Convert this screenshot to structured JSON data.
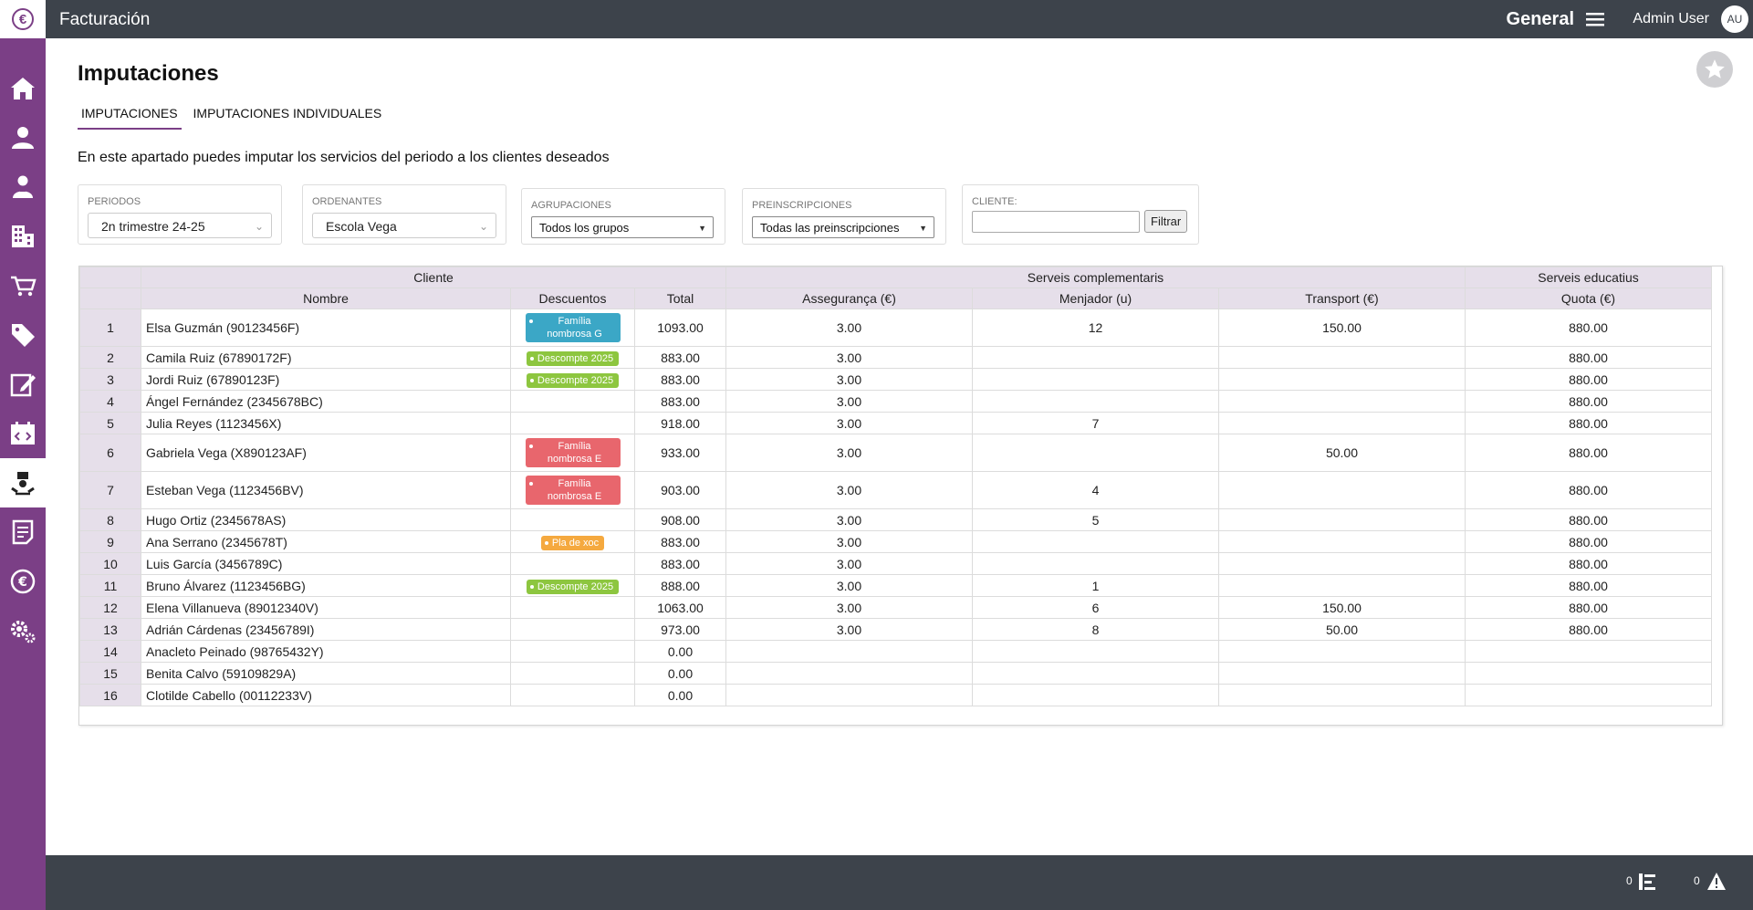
{
  "app": {
    "logo_glyph": "€",
    "title": "Facturación",
    "company": "General",
    "user_name": "Admin User",
    "user_initials": "AU"
  },
  "sidebar": {
    "items": [
      {
        "icon": "home-icon"
      },
      {
        "icon": "user-icon"
      },
      {
        "icon": "user-alt-icon"
      },
      {
        "icon": "building-icon"
      },
      {
        "icon": "cart-icon"
      },
      {
        "icon": "tag-icon"
      },
      {
        "icon": "edit-icon"
      },
      {
        "icon": "calendar-code-icon"
      },
      {
        "icon": "imputations-icon",
        "active": true
      },
      {
        "icon": "document-icon"
      },
      {
        "icon": "euro-icon"
      },
      {
        "icon": "settings-icon"
      }
    ]
  },
  "page": {
    "title": "Imputaciones",
    "tabs": [
      {
        "label": "IMPUTACIONES",
        "active": true
      },
      {
        "label": "IMPUTACIONES INDIVIDUALES",
        "active": false
      }
    ],
    "description": "En este apartado puedes imputar los servicios del periodo a los clientes deseados"
  },
  "filters": {
    "periodos": {
      "label": "PERIODOS",
      "value": "2n trimestre 24-25"
    },
    "ordenantes": {
      "label": "ORDENANTES",
      "value": "Escola Vega"
    },
    "agrupaciones": {
      "label": "AGRUPACIONES",
      "value": "Todos los grupos"
    },
    "preinscripciones": {
      "label": "PREINSCRIPCIONES",
      "value": "Todas las preinscripciones"
    },
    "cliente": {
      "label": "CLIENTE:",
      "value": "",
      "button": "Filtrar"
    }
  },
  "table": {
    "groups": [
      "Cliente",
      "Serveis complementaris",
      "Serveis educatius"
    ],
    "columns": [
      "Nombre",
      "Descuentos",
      "Total",
      "Assegurança (€)",
      "Menjador (u)",
      "Transport (€)",
      "Quota (€)"
    ],
    "rows": [
      {
        "n": "1",
        "name": "Elsa Guzmán (90123456F)",
        "discount": "Família nombrosa G",
        "dcolor": "#3ba7c6",
        "total": "1093.00",
        "seg": "3.00",
        "menj": "12",
        "trans": "150.00",
        "quota": "880.00"
      },
      {
        "n": "2",
        "name": "Camila Ruiz (67890172F)",
        "discount": "Descompte 2025",
        "dcolor": "#8dc63f",
        "total": "883.00",
        "seg": "3.00",
        "menj": "",
        "trans": "",
        "quota": "880.00"
      },
      {
        "n": "3",
        "name": "Jordi Ruiz (67890123F)",
        "discount": "Descompte 2025",
        "dcolor": "#8dc63f",
        "total": "883.00",
        "seg": "3.00",
        "menj": "",
        "trans": "",
        "quota": "880.00"
      },
      {
        "n": "4",
        "name": "Ángel Fernández (2345678BC)",
        "discount": "",
        "dcolor": "",
        "total": "883.00",
        "seg": "3.00",
        "menj": "",
        "trans": "",
        "quota": "880.00"
      },
      {
        "n": "5",
        "name": "Julia Reyes (1123456X)",
        "discount": "",
        "dcolor": "",
        "total": "918.00",
        "seg": "3.00",
        "menj": "7",
        "trans": "",
        "quota": "880.00"
      },
      {
        "n": "6",
        "name": "Gabriela Vega (X890123AF)",
        "discount": "Família nombrosa E",
        "dcolor": "#e8666d",
        "total": "933.00",
        "seg": "3.00",
        "menj": "",
        "trans": "50.00",
        "quota": "880.00"
      },
      {
        "n": "7",
        "name": "Esteban Vega (1123456BV)",
        "discount": "Família nombrosa E",
        "dcolor": "#e8666d",
        "total": "903.00",
        "seg": "3.00",
        "menj": "4",
        "trans": "",
        "quota": "880.00"
      },
      {
        "n": "8",
        "name": "Hugo Ortiz (2345678AS)",
        "discount": "",
        "dcolor": "",
        "total": "908.00",
        "seg": "3.00",
        "menj": "5",
        "trans": "",
        "quota": "880.00"
      },
      {
        "n": "9",
        "name": "Ana Serrano (2345678T)",
        "discount": "Pla de xoc",
        "dcolor": "#f5a93f",
        "total": "883.00",
        "seg": "3.00",
        "menj": "",
        "trans": "",
        "quota": "880.00"
      },
      {
        "n": "10",
        "name": "Luis García (3456789C)",
        "discount": "",
        "dcolor": "",
        "total": "883.00",
        "seg": "3.00",
        "menj": "",
        "trans": "",
        "quota": "880.00"
      },
      {
        "n": "11",
        "name": "Bruno Álvarez (1123456BG)",
        "discount": "Descompte 2025",
        "dcolor": "#8dc63f",
        "total": "888.00",
        "seg": "3.00",
        "menj": "1",
        "trans": "",
        "quota": "880.00"
      },
      {
        "n": "12",
        "name": "Elena Villanueva (89012340V)",
        "discount": "",
        "dcolor": "",
        "total": "1063.00",
        "seg": "3.00",
        "menj": "6",
        "trans": "150.00",
        "quota": "880.00"
      },
      {
        "n": "13",
        "name": "Adrián Cárdenas (23456789I)",
        "discount": "",
        "dcolor": "",
        "total": "973.00",
        "seg": "3.00",
        "menj": "8",
        "trans": "50.00",
        "quota": "880.00"
      },
      {
        "n": "14",
        "name": "Anacleto Peinado (98765432Y)",
        "discount": "",
        "dcolor": "",
        "total": "0.00",
        "seg": "",
        "menj": "",
        "trans": "",
        "quota": ""
      },
      {
        "n": "15",
        "name": "Benita Calvo (59109829A)",
        "discount": "",
        "dcolor": "",
        "total": "0.00",
        "seg": "",
        "menj": "",
        "trans": "",
        "quota": ""
      },
      {
        "n": "16",
        "name": "Clotilde Cabello (00112233V)",
        "discount": "",
        "dcolor": "",
        "total": "0.00",
        "seg": "",
        "menj": "",
        "trans": "",
        "quota": ""
      }
    ]
  },
  "footer": {
    "tasks_count": "0",
    "warnings_count": "0"
  }
}
